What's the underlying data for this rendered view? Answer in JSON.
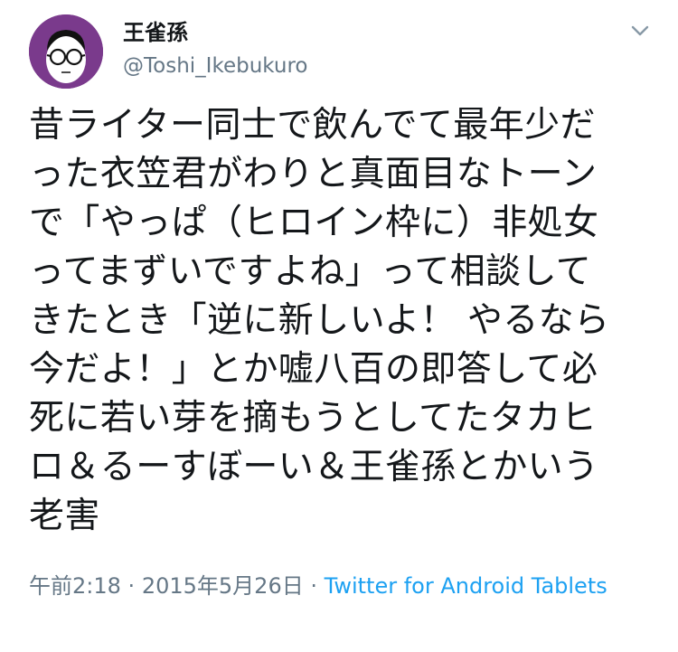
{
  "user": {
    "display_name": "王雀孫",
    "handle": "@Toshi_Ikebukuro",
    "avatar_background": "#7a3a8c"
  },
  "tweet": {
    "text": "昔ライター同士で飲んでて最年少だ\nった衣笠君がわりと真面目なトーン\nで「やっぱ（ヒロイン枠に）非処女\nってまずいですよね」って相談して\nきたとき「逆に新しいよ！ やるなら\n今だよ！」とか嘘八百の即答して必\n死に若い芽を摘もうとしてたタカヒ\nロ＆るーすぼーい＆王雀孫とかいう\n老害"
  },
  "meta": {
    "time": "午前2:18",
    "separator": "·",
    "date": "2015年5月26日",
    "source": "Twitter for Android Tablets"
  },
  "icons": {
    "caret": "chevron-down-icon",
    "avatar": "glasses-face-avatar"
  },
  "colors": {
    "link": "#1da1f2",
    "secondary_text": "#657786",
    "primary_text": "#14171a"
  }
}
